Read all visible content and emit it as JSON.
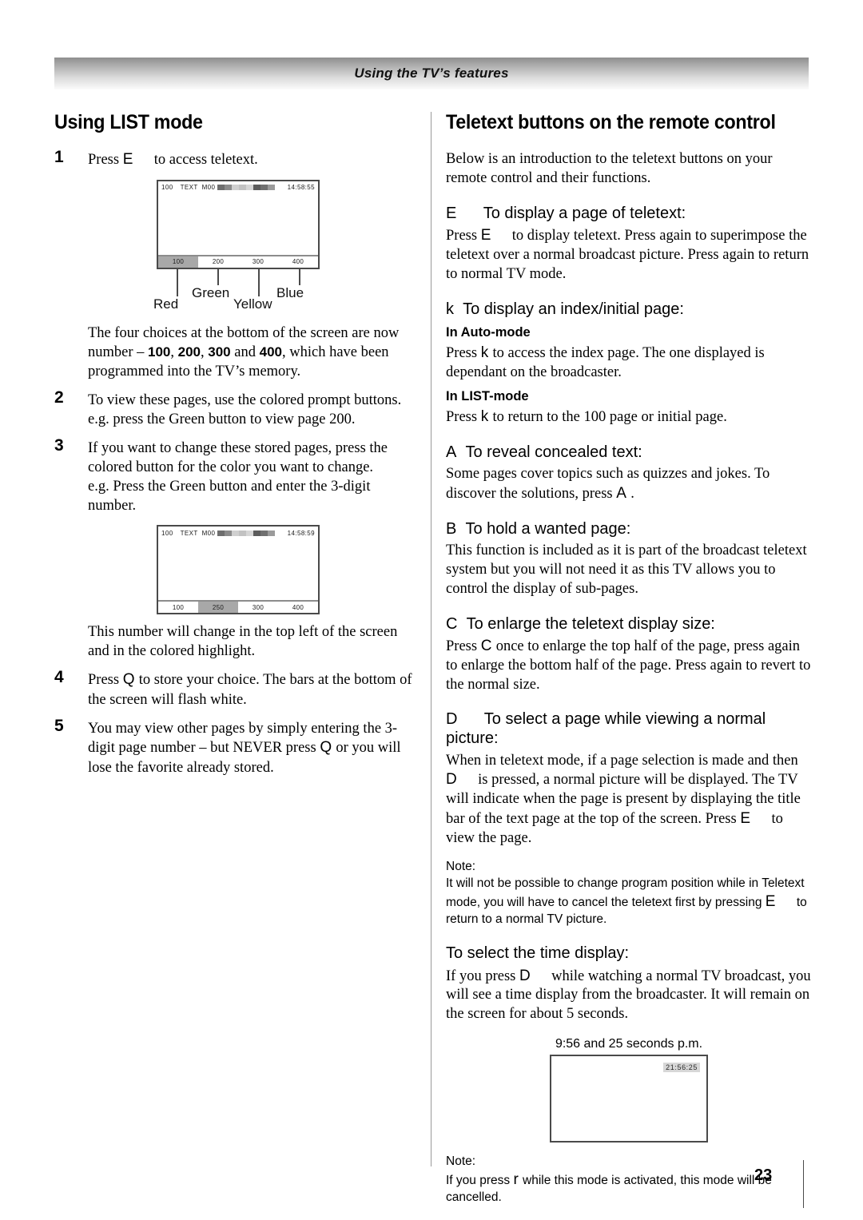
{
  "header": {
    "band_title": "Using the TV’s features"
  },
  "left_column": {
    "heading": "Using LIST mode",
    "steps": [
      {
        "num": "1",
        "text_before_key": "Press ",
        "key": "E",
        "text_after_key": "to access teletext."
      },
      {
        "num": "2",
        "line1": "To view these pages, use the colored prompt buttons.",
        "line2": "e.g. press the Green button to view page 200."
      },
      {
        "num": "3",
        "line1": "If you want to change these stored pages, press the",
        "line2": "colored button for the color you want to change.",
        "line3": "e.g. Press the Green button and enter the 3-digit number."
      },
      {
        "num": "4",
        "text_before_key": "Press ",
        "key": "Q",
        "text_after_key": "to store your choice. The bars at the bottom of the screen will flash white."
      },
      {
        "num": "5",
        "part1": "You may view other pages by simply entering the 3-digit page number – but NEVER press ",
        "key": "Q",
        "part2": "or you will lose the favorite already stored."
      }
    ],
    "para_after_fig1": {
      "seg1": "The four choices at the bottom of the screen are now number – ",
      "n1": "100",
      "sep1": ", ",
      "n2": "200",
      "sep2": ", ",
      "n3": "300",
      "sep3": " and ",
      "n4": "400",
      "seg2": ", which have been programmed into the TV’s memory."
    },
    "para_after_fig2": "This number will change in the top left of the screen and in the colored highlight.",
    "figure1": {
      "status": {
        "page": "100",
        "text_label": "TEXT",
        "mode": "M00",
        "time": "14:58:55"
      },
      "blocks": [
        "#6e6e6e",
        "#8b8b8b",
        "#d0d0d0",
        "#c2c2c2",
        "#d6d6d6",
        "#5c5c5c",
        "#707070",
        "#9b9b9b"
      ],
      "page_bar": [
        {
          "label": "100",
          "highlight": true
        },
        {
          "label": "200",
          "highlight": false
        },
        {
          "label": "300",
          "highlight": false
        },
        {
          "label": "400",
          "highlight": false
        }
      ],
      "callouts": [
        "Red",
        "Green",
        "Yellow",
        "Blue"
      ]
    },
    "figure2": {
      "status": {
        "page": "100",
        "text_label": "TEXT",
        "mode": "M00",
        "time": "14:58:59"
      },
      "blocks": [
        "#6e6e6e",
        "#8b8b8b",
        "#d0d0d0",
        "#c2c2c2",
        "#d6d6d6",
        "#5c5c5c",
        "#707070",
        "#9b9b9b"
      ],
      "page_bar": [
        {
          "label": "100",
          "highlight": false
        },
        {
          "label": "250",
          "highlight": true
        },
        {
          "label": "300",
          "highlight": false
        },
        {
          "label": "400",
          "highlight": false
        }
      ]
    }
  },
  "right_column": {
    "heading": "Teletext buttons on the remote control",
    "intro": "Below is an introduction to the teletext buttons on your remote control and their functions.",
    "sections": [
      {
        "key": "E",
        "title": "To display a page of teletext:",
        "body_pre": "Press ",
        "body_key": "E",
        "body_post": "to display teletext. Press again to superimpose the teletext over a normal broadcast picture. Press again to return to normal TV mode."
      },
      {
        "key": "k",
        "title": "To display an index/initial page:",
        "sub1": "In Auto-mode",
        "sub1_pre": "Press ",
        "sub1_key": "k",
        "sub1_post": "to access the index page. The one displayed is dependant on the broadcaster.",
        "sub2": "In LIST-mode",
        "sub2_pre": "Press ",
        "sub2_key": "k",
        "sub2_post": "to return to the 100 page or initial page."
      },
      {
        "key": "A",
        "title": "To reveal concealed text:",
        "body_pre": "Some pages cover topics such as quizzes and jokes. To discover the solutions, press ",
        "body_key": "A",
        "body_post": "."
      },
      {
        "key": "B",
        "title": "To hold a wanted page:",
        "body_pre": "This function is included as it is part of the broadcast teletext system but you will not need it as this TV allows you to control the display of sub-pages.",
        "body_key": "",
        "body_post": ""
      },
      {
        "key": "C",
        "title": "To enlarge the teletext display size:",
        "body_pre": "Press ",
        "body_key": "C",
        "body_post": "once to enlarge the top half of the page, press again to enlarge the bottom half of the page. Press again to revert to the normal size."
      },
      {
        "key": "D",
        "title": "To select a page while viewing a normal picture:",
        "body_seg1": "When in teletext mode, if a page selection is made and then ",
        "body_key1": "D",
        "body_seg2": "is pressed, a normal picture will be displayed. The TV will indicate when the page is present by displaying the title bar of the text page at the top of the screen. Press ",
        "body_key2": "E",
        "body_seg3": "to view the page."
      }
    ],
    "note1": {
      "label": "Note:",
      "seg1": "It will not be possible to change program position while in Teletext mode, you will have to cancel the teletext first by pressing ",
      "key": "E",
      "seg2": "to return to a normal TV picture."
    },
    "time_section": {
      "title": "To select the time display:",
      "body_pre": "If you press ",
      "body_key": "D",
      "body_post": "while watching a normal TV broadcast, you will see a time display from the broadcaster. It will remain on the screen for about 5 seconds."
    },
    "time_figure": {
      "caption": "9:56 and 25 seconds p.m.",
      "clock": "21:56:25"
    },
    "note2": {
      "label": "Note:",
      "seg1": "If you press ",
      "key": "r",
      "seg2": "while this mode is activated, this mode will be cancelled."
    }
  },
  "footer": {
    "page_number": "23"
  }
}
